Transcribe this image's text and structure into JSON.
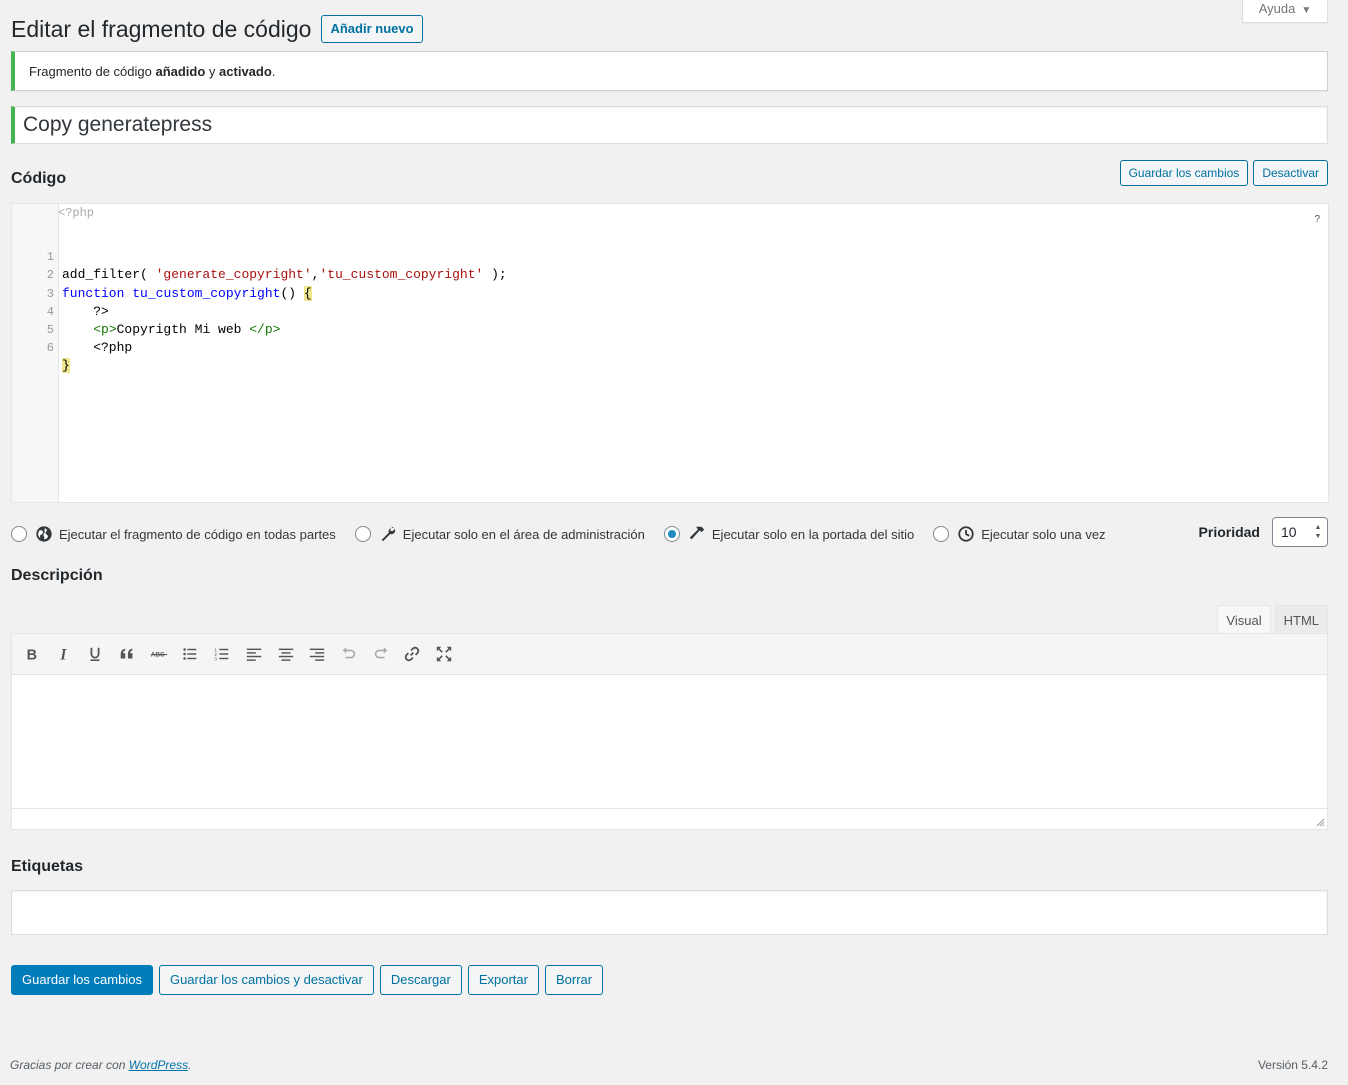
{
  "help": {
    "label": "Ayuda"
  },
  "header": {
    "title": "Editar el fragmento de código",
    "add_new": "Añadir nuevo"
  },
  "notice": {
    "prefix": "Fragmento de código ",
    "word1": "añadido",
    "mid": " y ",
    "word2": "activado",
    "suffix": "."
  },
  "snippet": {
    "title": "Copy generatepress"
  },
  "code_section": {
    "label": "Código",
    "save_button": "Guardar los cambios",
    "deactivate_button": "Desactivar",
    "php_open": "<?php",
    "help_mark": "?",
    "line_numbers": [
      "1",
      "2",
      "3",
      "4",
      "5",
      "6"
    ],
    "lines": [
      "add_filter( 'generate_copyright','tu_custom_copyright' );",
      "function tu_custom_copyright() {",
      "    ?>",
      "    <p>Copyrigth Mi web </p>",
      "    <?php",
      "}"
    ]
  },
  "scope": {
    "options": [
      {
        "label": "Ejecutar el fragmento de código en todas partes",
        "icon": "globe-icon",
        "checked": false
      },
      {
        "label": "Ejecutar solo en el área de administración",
        "icon": "wrench-icon",
        "checked": false
      },
      {
        "label": "Ejecutar solo en la portada del sitio",
        "icon": "hammer-icon",
        "checked": true
      },
      {
        "label": "Ejecutar solo una vez",
        "icon": "clock-icon",
        "checked": false
      }
    ],
    "priority_label": "Prioridad",
    "priority_value": "10"
  },
  "description": {
    "label": "Descripción",
    "tab_visual": "Visual",
    "tab_html": "HTML",
    "toolbar_icons": [
      "bold-icon",
      "italic-icon",
      "underline-icon",
      "blockquote-icon",
      "strikethrough-icon",
      "bullet-list-icon",
      "numbered-list-icon",
      "align-left-icon",
      "align-center-icon",
      "align-right-icon",
      "undo-icon",
      "redo-icon",
      "link-icon",
      "fullscreen-icon"
    ]
  },
  "tags": {
    "label": "Etiquetas"
  },
  "actions": {
    "save": "Guardar los cambios",
    "save_deactivate": "Guardar los cambios y desactivar",
    "download": "Descargar",
    "export": "Exportar",
    "delete": "Borrar"
  },
  "footer": {
    "text": "Gracias por crear con ",
    "link": "WordPress",
    "version": "Versión 5.4.2"
  },
  "colors": {
    "accent": "#0071a1",
    "primary": "#007cba",
    "success": "#46b450"
  }
}
